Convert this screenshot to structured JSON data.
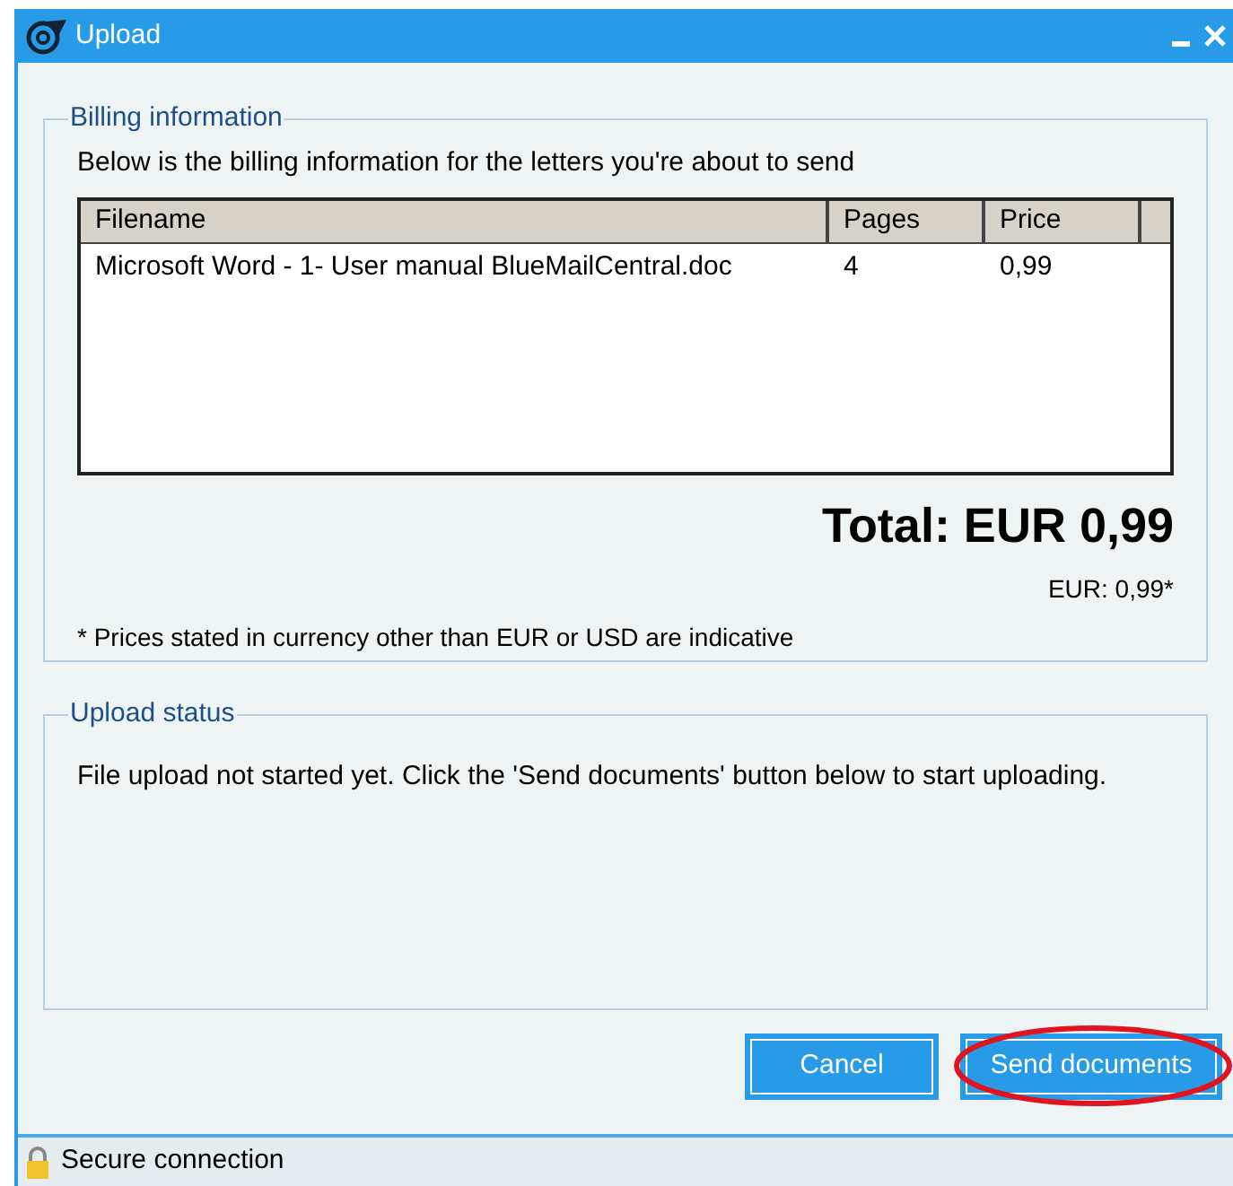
{
  "window": {
    "title": "Upload"
  },
  "billing": {
    "legend": "Billing information",
    "intro": "Below is the billing information for the letters you're about to send",
    "columns": [
      "Filename",
      "Pages",
      "Price"
    ],
    "rows": [
      [
        "Microsoft Word - 1- User manual BlueMailCentral.doc",
        "4",
        "0,99"
      ]
    ],
    "total": "Total: EUR 0,99",
    "subtotal": "EUR: 0,99*",
    "note": "* Prices stated in currency other than EUR or USD are indicative"
  },
  "upload_status": {
    "legend": "Upload status",
    "message": "File upload not started yet. Click the 'Send documents' button below to start uploading."
  },
  "buttons": [
    {
      "label": "Cancel",
      "highlighted": false
    },
    {
      "label": "Send documents",
      "highlighted": true
    }
  ],
  "status_bar": {
    "text": "Secure connection"
  }
}
